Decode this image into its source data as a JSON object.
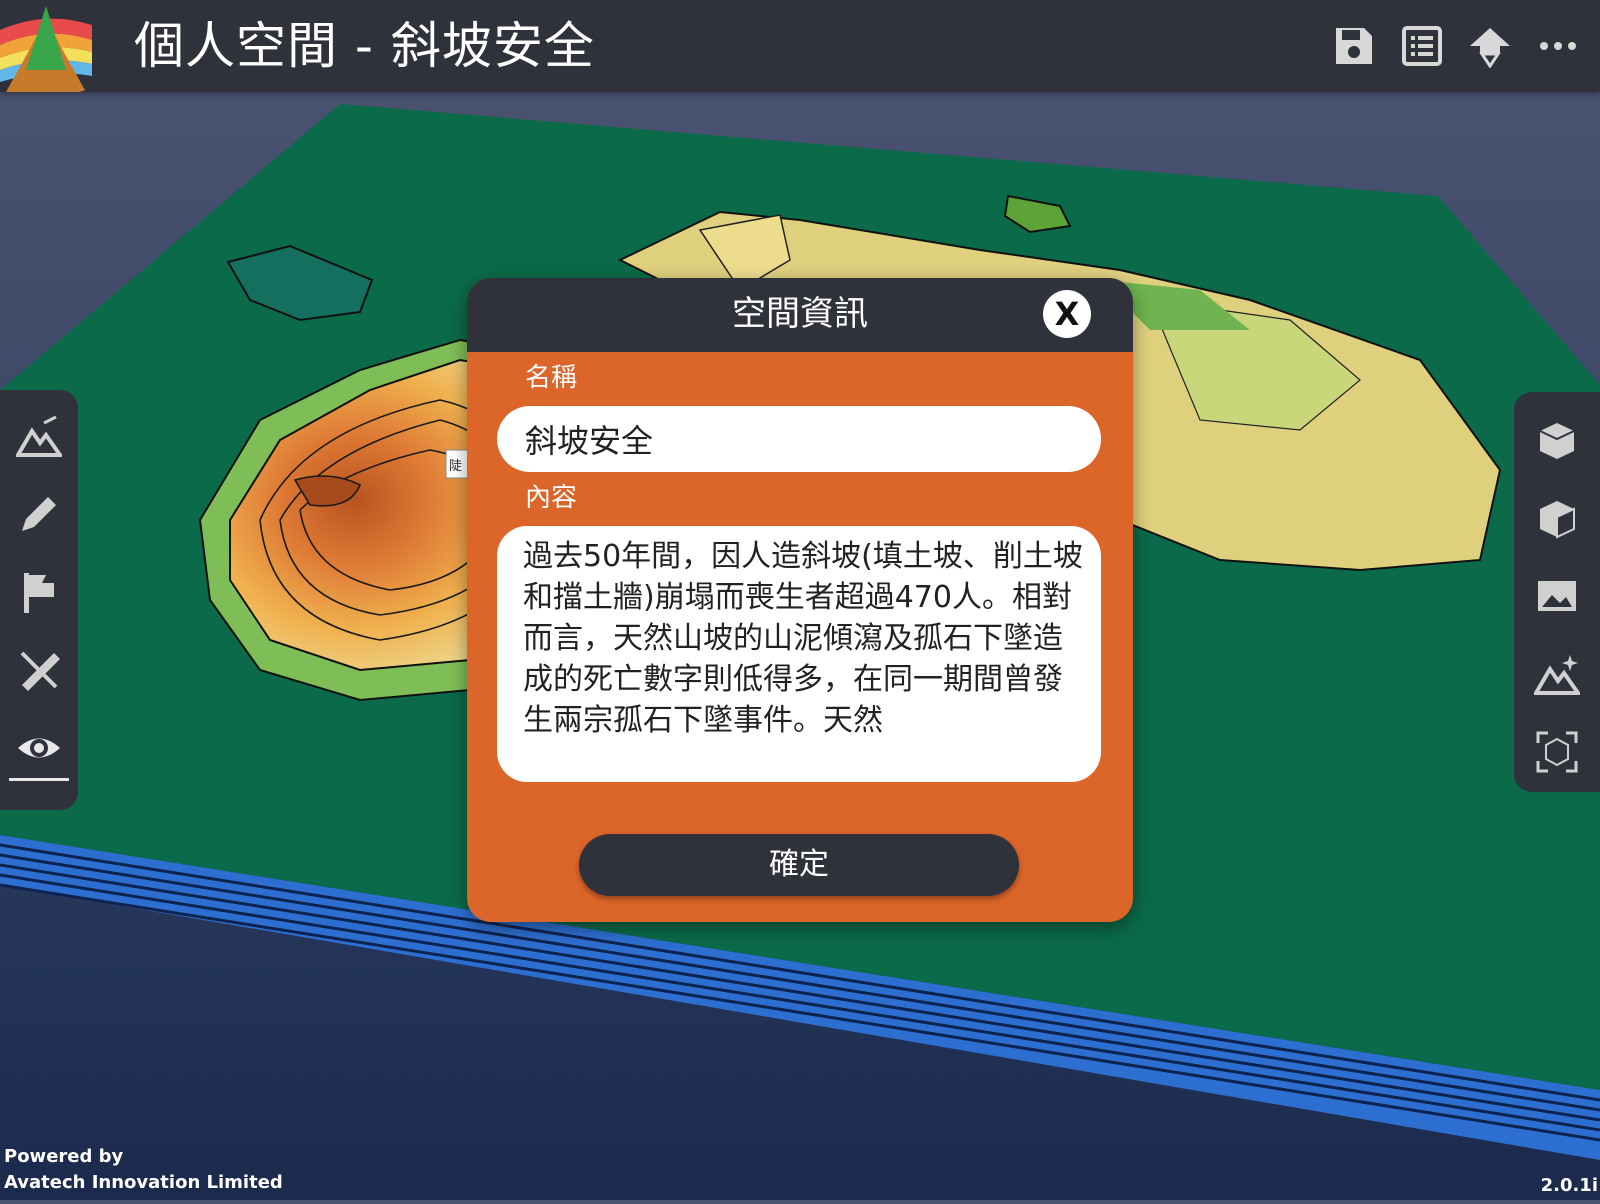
{
  "header": {
    "title": "個人空間 - 斜坡安全",
    "icons": [
      "save-icon",
      "list-icon",
      "download-icon",
      "more-icon"
    ]
  },
  "map_label": "陡",
  "left_toolbar": [
    "terrain-tool-icon",
    "pencil-icon",
    "flag-icon",
    "measure-icon",
    "eye-icon"
  ],
  "right_toolbar": [
    "box-icon",
    "box-side-icon",
    "image-icon",
    "terrain-sparkle-icon",
    "ar-icon"
  ],
  "dialog": {
    "title": "空間資訊",
    "close_label": "X",
    "name_label": "名稱",
    "name_value": "斜坡安全",
    "content_label": "內容",
    "content_value": "過去50年間，因人造斜坡(填土坡、削土坡和擋土牆)崩塌而喪生者超過470人。相對而言，天然山坡的山泥傾瀉及孤石下墜造成的死亡數字則低得多，在同一期間曾發生兩宗孤石下墜事件。天然",
    "confirm_label": "確定"
  },
  "footer": {
    "powered_by": "Powered by",
    "company": "Avatech Innovation Limited",
    "version": "2.0.1i"
  },
  "colors": {
    "bar": "#30323b",
    "dialog": "#dc6529",
    "board": "#0b6a49",
    "water": "#1f3b72"
  }
}
